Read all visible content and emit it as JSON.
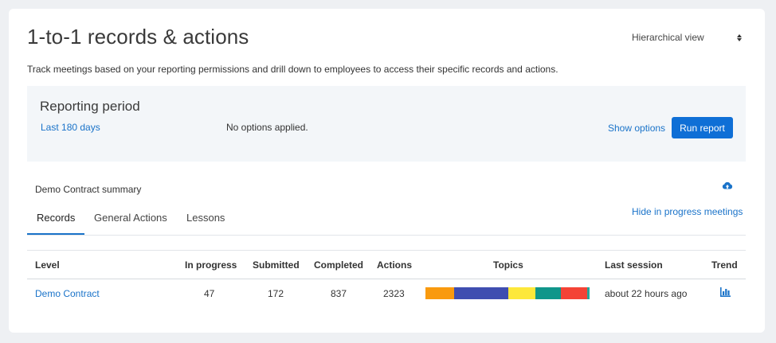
{
  "header": {
    "title": "1-to-1 records & actions",
    "view_select": "Hierarchical view",
    "description": "Track meetings based on your reporting permissions and drill down to employees to access their specific records and actions."
  },
  "reporting_period": {
    "title": "Reporting period",
    "period": "Last 180 days",
    "options_status": "No options applied.",
    "show_options": "Show options",
    "run_report": "Run report"
  },
  "summary": {
    "label": "Demo Contract summary",
    "hide_in_progress": "Hide in progress meetings"
  },
  "tabs": [
    {
      "label": "Records",
      "active": true
    },
    {
      "label": "General Actions",
      "active": false
    },
    {
      "label": "Lessons",
      "active": false
    }
  ],
  "table": {
    "headers": {
      "level": "Level",
      "in_progress": "In progress",
      "submitted": "Submitted",
      "completed": "Completed",
      "actions": "Actions",
      "topics": "Topics",
      "last_session": "Last session",
      "trend": "Trend"
    },
    "rows": [
      {
        "level": "Demo Contract",
        "in_progress": "47",
        "submitted": "172",
        "completed": "837",
        "actions": "2323",
        "last_session": "about 22 hours ago",
        "topics": [
          {
            "color": "#f99a0e",
            "fraction": 0.175
          },
          {
            "color": "#3f4eb0",
            "fraction": 0.33
          },
          {
            "color": "#fde83a",
            "fraction": 0.165
          },
          {
            "color": "#10968a",
            "fraction": 0.155
          },
          {
            "color": "#f44336",
            "fraction": 0.16
          },
          {
            "color": "#26a69a",
            "fraction": 0.015
          }
        ]
      }
    ]
  },
  "icons": {
    "view_select": "sort-arrows-icon",
    "upload": "cloud-upload-icon",
    "trend": "bar-chart-icon"
  },
  "colors": {
    "accent": "#1a73c9",
    "button": "#0f6fd6",
    "panel": "#f3f6f9"
  }
}
